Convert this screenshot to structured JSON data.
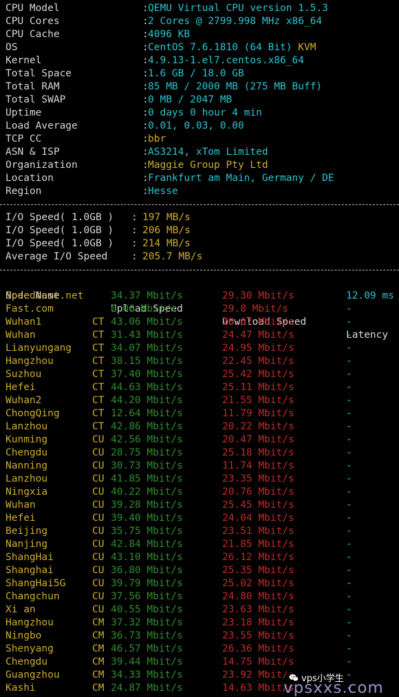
{
  "sysinfo": [
    {
      "key": "CPU Model",
      "value": "QEMU Virtual CPU version 1.5.3",
      "color": "cyan"
    },
    {
      "key": "CPU Cores",
      "value": "2 Cores @ 2799.998 MHz x86_64",
      "color": "cyan"
    },
    {
      "key": "CPU Cache",
      "value": "4096 KB",
      "color": "cyan"
    },
    {
      "key": "OS",
      "value": "CentOS 7.6.1810 (64 Bit) KVM",
      "color": "cyan",
      "extra": "KVM"
    },
    {
      "key": "Kernel",
      "value": "4.9.13-1.el7.centos.x86_64",
      "color": "cyan"
    },
    {
      "key": "Total Space",
      "value": "1.6 GB / 18.0 GB",
      "color": "cyan"
    },
    {
      "key": "Total RAM",
      "value": "85 MB / 2000 MB (275 MB Buff)",
      "color": "cyan"
    },
    {
      "key": "Total SWAP",
      "value": "0 MB / 2047 MB",
      "color": "cyan"
    },
    {
      "key": "Uptime",
      "value": "0 days 0 hour 4 min",
      "color": "cyan"
    },
    {
      "key": "Load Average",
      "value": "0.01, 0.03, 0.00",
      "color": "cyan"
    },
    {
      "key": "TCP CC",
      "value": "bbr",
      "color": "yellow"
    },
    {
      "key": "ASN & ISP",
      "value": "AS3214, xTom Limited",
      "color": "cyan"
    },
    {
      "key": "Organization",
      "value": "Maggie Group Pty Ltd",
      "color": "yellow"
    },
    {
      "key": "Location",
      "value": "Frankfurt am Main, Germany / DE",
      "color": "cyan"
    },
    {
      "key": "Region",
      "value": "Hesse",
      "color": "cyan"
    }
  ],
  "separator": ":",
  "io": [
    {
      "key": "I/O Speed( 1.0GB )",
      "value": "197 MB/s"
    },
    {
      "key": "I/O Speed( 1.0GB )",
      "value": "206 MB/s"
    },
    {
      "key": "I/O Speed( 1.0GB )",
      "value": "214 MB/s"
    },
    {
      "key": "Average I/O Speed",
      "value": "205.7 MB/s"
    }
  ],
  "speed_header": {
    "node": "Node Name",
    "upload": "Upload Speed",
    "download": "Download Speed",
    "latency": "Latency"
  },
  "speed_rows": [
    {
      "node": "Speedtest.net",
      "isp": "",
      "up": "34.37 Mbit/s",
      "down": "29.30 Mbit/s",
      "lat": "12.09 ms"
    },
    {
      "node": "Fast.com",
      "isp": "",
      "up": "0.00 Mbit/s",
      "down": "29.8 Mbit/s",
      "lat": "-"
    },
    {
      "node": "Wuhan1",
      "isp": "CT",
      "up": "43.06 Mbit/s",
      "down": "20.67 Mbit/s",
      "lat": "-"
    },
    {
      "node": "Wuhan",
      "isp": "CT",
      "up": "31.43 Mbit/s",
      "down": "24.47 Mbit/s",
      "lat": "-"
    },
    {
      "node": "Lianyungang",
      "isp": "CT",
      "up": "34.07 Mbit/s",
      "down": "24.95 Mbit/s",
      "lat": "-"
    },
    {
      "node": "Hangzhou",
      "isp": "CT",
      "up": "38.15 Mbit/s",
      "down": "22.45 Mbit/s",
      "lat": "-"
    },
    {
      "node": "Suzhou",
      "isp": "CT",
      "up": "37.40 Mbit/s",
      "down": "25.42 Mbit/s",
      "lat": "-"
    },
    {
      "node": "Hefei",
      "isp": "CT",
      "up": "44.63 Mbit/s",
      "down": "25.11 Mbit/s",
      "lat": "-"
    },
    {
      "node": "Wuhan2",
      "isp": "CT",
      "up": "44.20 Mbit/s",
      "down": "21.55 Mbit/s",
      "lat": "-"
    },
    {
      "node": "ChongQing",
      "isp": "CT",
      "up": "12.64 Mbit/s",
      "down": "11.79 Mbit/s",
      "lat": "-"
    },
    {
      "node": "Lanzhou",
      "isp": "CT",
      "up": "42.86 Mbit/s",
      "down": "20.22 Mbit/s",
      "lat": "-"
    },
    {
      "node": "Kunming",
      "isp": "CU",
      "up": "42.56 Mbit/s",
      "down": "20.47 Mbit/s",
      "lat": "-"
    },
    {
      "node": "Chengdu",
      "isp": "CU",
      "up": "28.75 Mbit/s",
      "down": "25.18 Mbit/s",
      "lat": "-"
    },
    {
      "node": "Nanning",
      "isp": "CU",
      "up": "30.73 Mbit/s",
      "down": "11.74 Mbit/s",
      "lat": "-"
    },
    {
      "node": "Lanzhou",
      "isp": "CU",
      "up": "41.85 Mbit/s",
      "down": "23.35 Mbit/s",
      "lat": "-"
    },
    {
      "node": "Ningxia",
      "isp": "CU",
      "up": "40.22 Mbit/s",
      "down": "20.76 Mbit/s",
      "lat": "-"
    },
    {
      "node": "Wuhan",
      "isp": "CU",
      "up": "39.28 Mbit/s",
      "down": "25.45 Mbit/s",
      "lat": "-"
    },
    {
      "node": "Hefei",
      "isp": "CU",
      "up": "39.40 Mbit/s",
      "down": "24.04 Mbit/s",
      "lat": "-"
    },
    {
      "node": "Beijing",
      "isp": "CU",
      "up": "35.75 Mbit/s",
      "down": "23.51 Mbit/s",
      "lat": "-"
    },
    {
      "node": "Nanjing",
      "isp": "CU",
      "up": "42.84 Mbit/s",
      "down": "21.85 Mbit/s",
      "lat": "-"
    },
    {
      "node": "ShangHai",
      "isp": "CU",
      "up": "43.10 Mbit/s",
      "down": "26.12 Mbit/s",
      "lat": "-"
    },
    {
      "node": "Shanghai",
      "isp": "CU",
      "up": "36.80 Mbit/s",
      "down": "25.35 Mbit/s",
      "lat": "-"
    },
    {
      "node": "ShangHai5G",
      "isp": "CU",
      "up": "39.79 Mbit/s",
      "down": "25.02 Mbit/s",
      "lat": "-"
    },
    {
      "node": "Changchun",
      "isp": "CU",
      "up": "37.56 Mbit/s",
      "down": "24.80 Mbit/s",
      "lat": "-"
    },
    {
      "node": "Xi an",
      "isp": "CU",
      "up": "40.55 Mbit/s",
      "down": "23.63 Mbit/s",
      "lat": "-"
    },
    {
      "node": "Hangzhou",
      "isp": "CM",
      "up": "37.32 Mbit/s",
      "down": "23.18 Mbit/s",
      "lat": "-"
    },
    {
      "node": "Ningbo",
      "isp": "CM",
      "up": "36.73 Mbit/s",
      "down": "23.55 Mbit/s",
      "lat": "-"
    },
    {
      "node": "Shenyang",
      "isp": "CM",
      "up": "46.57 Mbit/s",
      "down": "26.36 Mbit/s",
      "lat": "-"
    },
    {
      "node": "Chengdu",
      "isp": "CM",
      "up": "39.44 Mbit/s",
      "down": "14.75 Mbit/s",
      "lat": "-"
    },
    {
      "node": "Guangzhou",
      "isp": "CM",
      "up": "34.33 Mbit/s",
      "down": "23.92 Mbit/s",
      "lat": "-"
    },
    {
      "node": "Kashi",
      "isp": "CM",
      "up": "24.87 Mbit/s",
      "down": "14.63 Mbit/s",
      "lat": "-"
    }
  ],
  "watermark": {
    "badge": "vps小学生",
    "text": "vpsxxs.com",
    "icon": "wechat-icon"
  },
  "colors": {
    "background": "#000000",
    "cyan": "#2bc5cf",
    "yellow": "#d0ad2e",
    "green": "#2f8e2e",
    "red": "#c22a2a",
    "white": "#d8d8d8"
  }
}
